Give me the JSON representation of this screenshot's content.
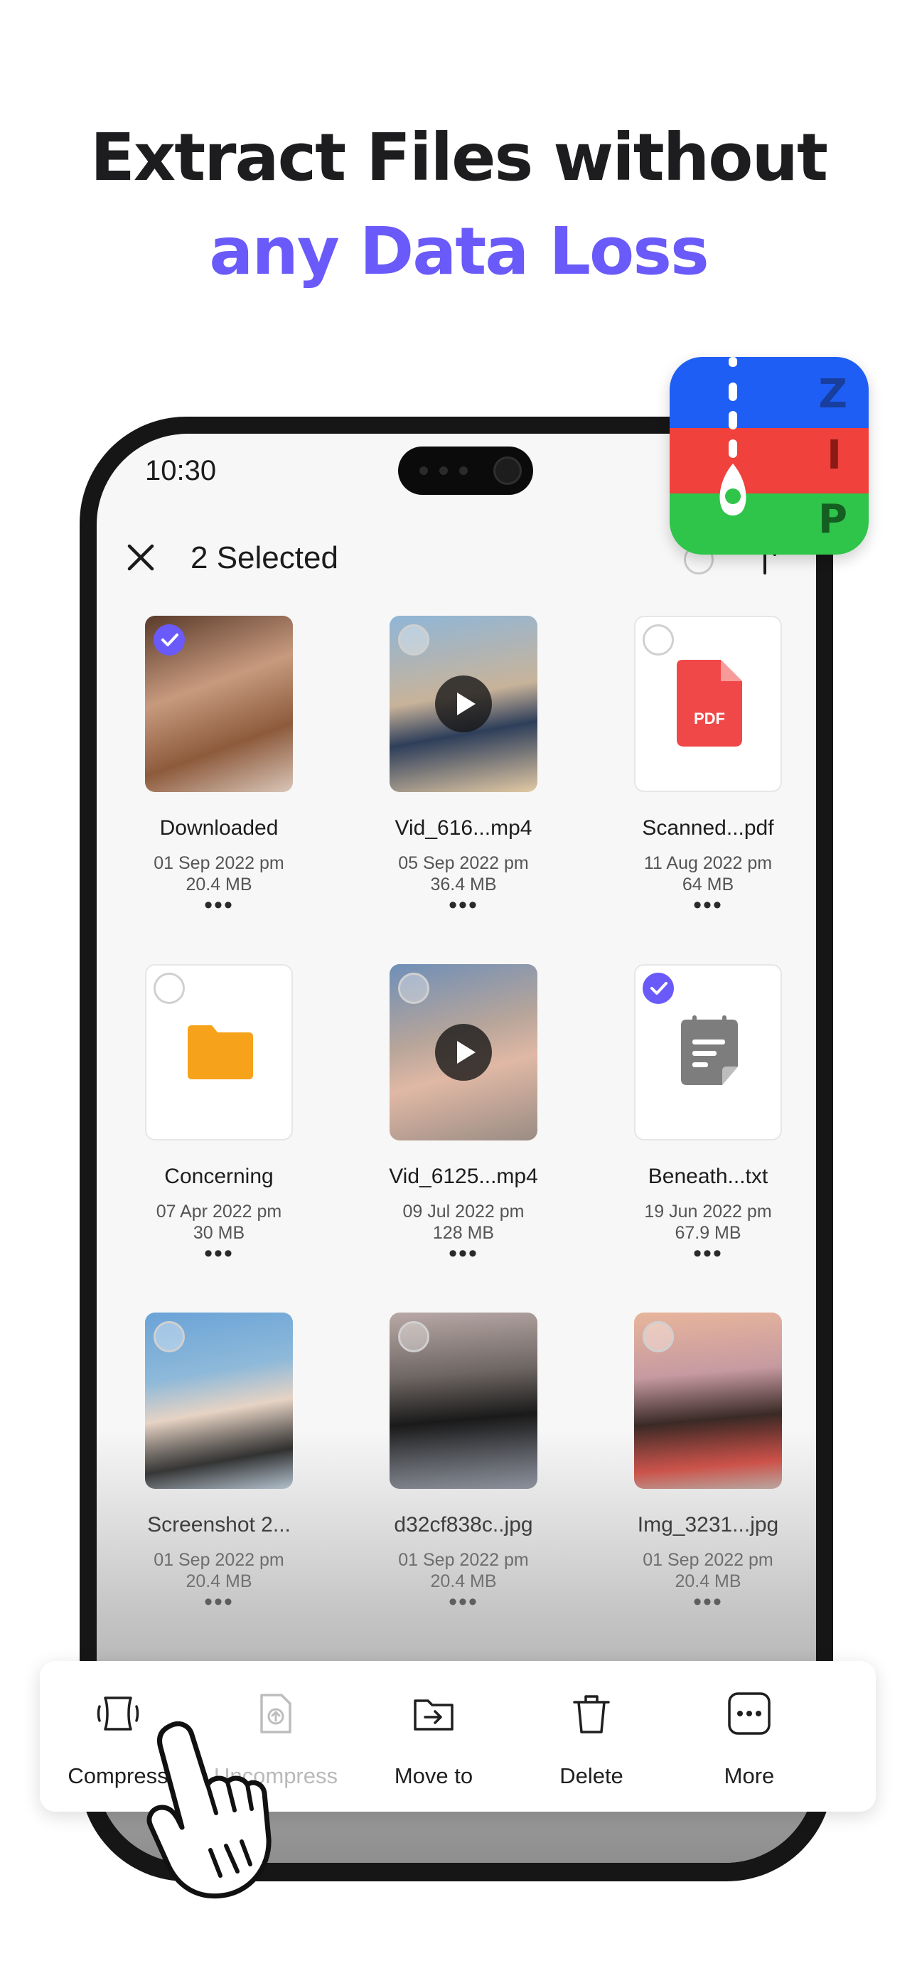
{
  "headline": {
    "line1": "Extract Files without",
    "line2": "any Data Loss"
  },
  "colors": {
    "accent": "#6a5af9",
    "zip_blue": "#1f5ef5",
    "zip_red": "#f0413c",
    "zip_green": "#2fc44a"
  },
  "zip_badge": {
    "letters": [
      "Z",
      "I",
      "P"
    ]
  },
  "status_bar": {
    "time": "10:30"
  },
  "topbar": {
    "title": "2 Selected"
  },
  "files": [
    {
      "name": "Downloaded",
      "date": "01 Sep 2022 pm",
      "size": "20.4 MB",
      "more": "•••",
      "selected": true,
      "kind": "image"
    },
    {
      "name": "Vid_616...mp4",
      "date": "05 Sep 2022 pm",
      "size": "36.4 MB",
      "more": "•••",
      "selected": false,
      "kind": "video"
    },
    {
      "name": "Scanned...pdf",
      "date": "11 Aug 2022 pm",
      "size": "64 MB",
      "more": "•••",
      "selected": false,
      "kind": "pdf",
      "badge": "PDF"
    },
    {
      "name": "Concerning",
      "date": "07 Apr 2022 pm",
      "size": "30 MB",
      "more": "•••",
      "selected": false,
      "kind": "folder"
    },
    {
      "name": "Vid_6125...mp4",
      "date": "09 Jul 2022 pm",
      "size": "128 MB",
      "more": "•••",
      "selected": false,
      "kind": "video"
    },
    {
      "name": "Beneath...txt",
      "date": "19 Jun 2022 pm",
      "size": "67.9 MB",
      "more": "•••",
      "selected": true,
      "kind": "text"
    },
    {
      "name": "Screenshot 2...",
      "date": "01 Sep 2022 pm",
      "size": "20.4 MB",
      "more": "•••",
      "selected": false,
      "kind": "image"
    },
    {
      "name": "d32cf838c..jpg",
      "date": "01 Sep 2022 pm",
      "size": "20.4 MB",
      "more": "•••",
      "selected": false,
      "kind": "image"
    },
    {
      "name": "Img_3231...jpg",
      "date": "01 Sep 2022 pm",
      "size": "20.4 MB",
      "more": "•••",
      "selected": false,
      "kind": "image"
    }
  ],
  "actions": [
    {
      "label": "Compress",
      "icon": "compress-icon",
      "enabled": true
    },
    {
      "label": "Uncompress",
      "icon": "uncompress-icon",
      "enabled": false
    },
    {
      "label": "Move to",
      "icon": "move-to-icon",
      "enabled": true
    },
    {
      "label": "Delete",
      "icon": "delete-icon",
      "enabled": true
    },
    {
      "label": "More",
      "icon": "more-icon",
      "enabled": true
    }
  ]
}
